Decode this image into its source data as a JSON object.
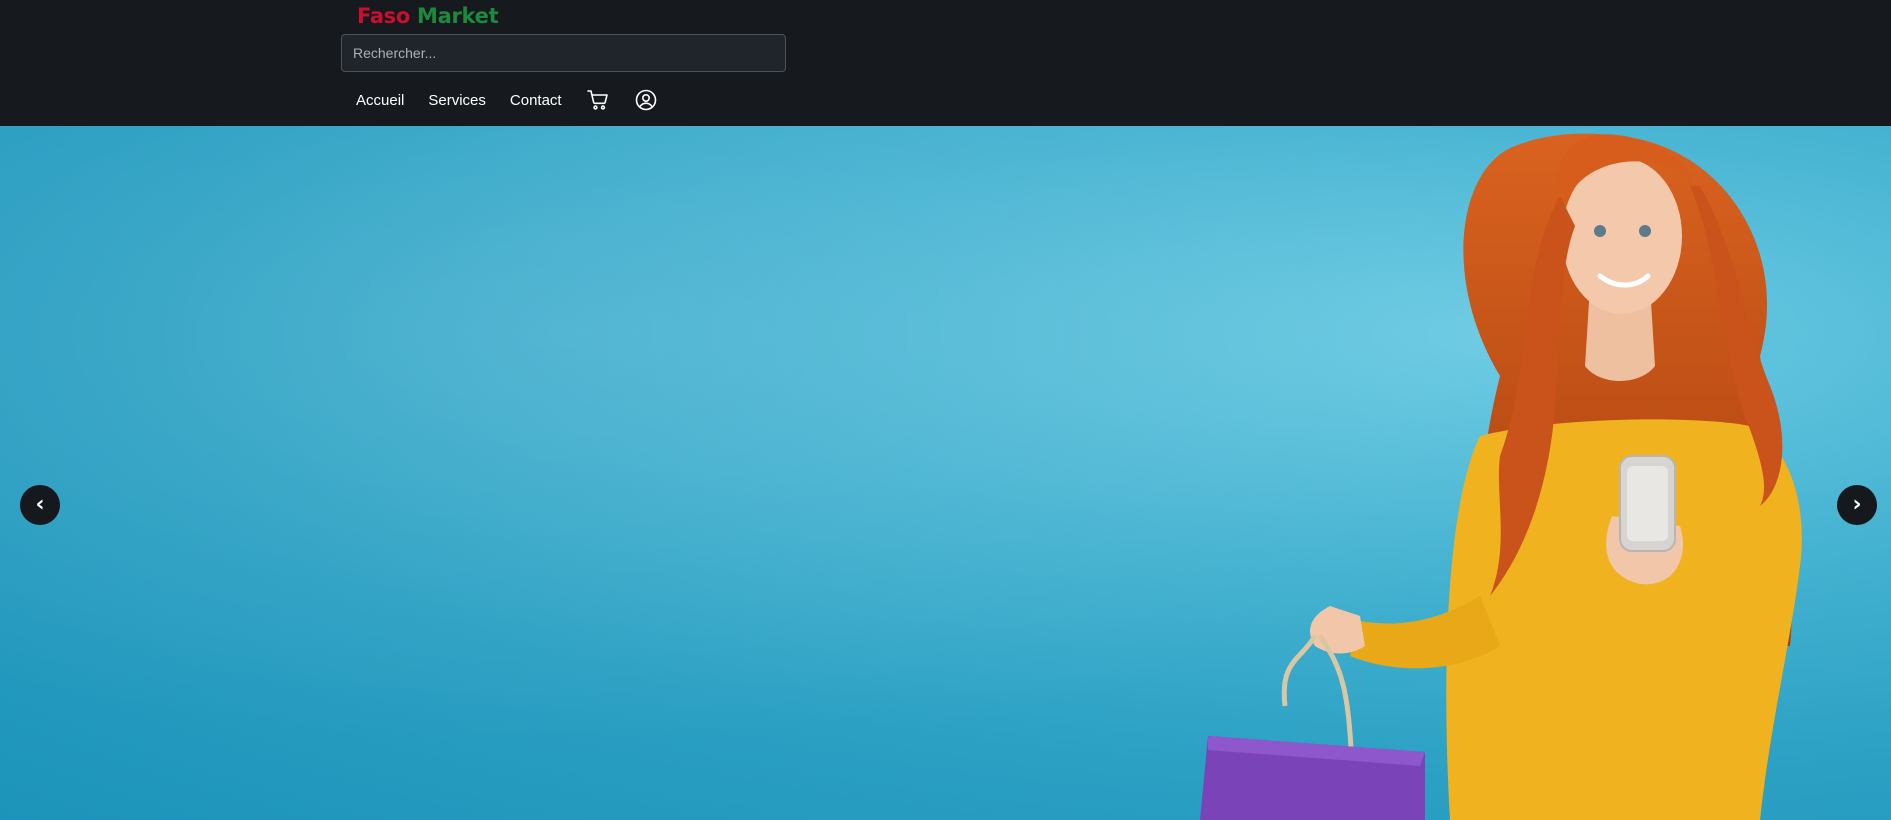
{
  "brand": {
    "part1": "Faso",
    "part2": "Market"
  },
  "search": {
    "placeholder": "Rechercher..."
  },
  "nav": {
    "items": [
      {
        "label": "Accueil"
      },
      {
        "label": "Services"
      },
      {
        "label": "Contact"
      }
    ]
  },
  "icons": {
    "cart": "cart-icon",
    "account": "user-circle-icon"
  },
  "carousel": {
    "prev_label": "‹",
    "next_label": "›"
  },
  "colors": {
    "navbar_bg": "#16191e",
    "brand_red": "#c8102e",
    "brand_green": "#1b8a3c",
    "hero_bg": "#2ba0c3"
  }
}
